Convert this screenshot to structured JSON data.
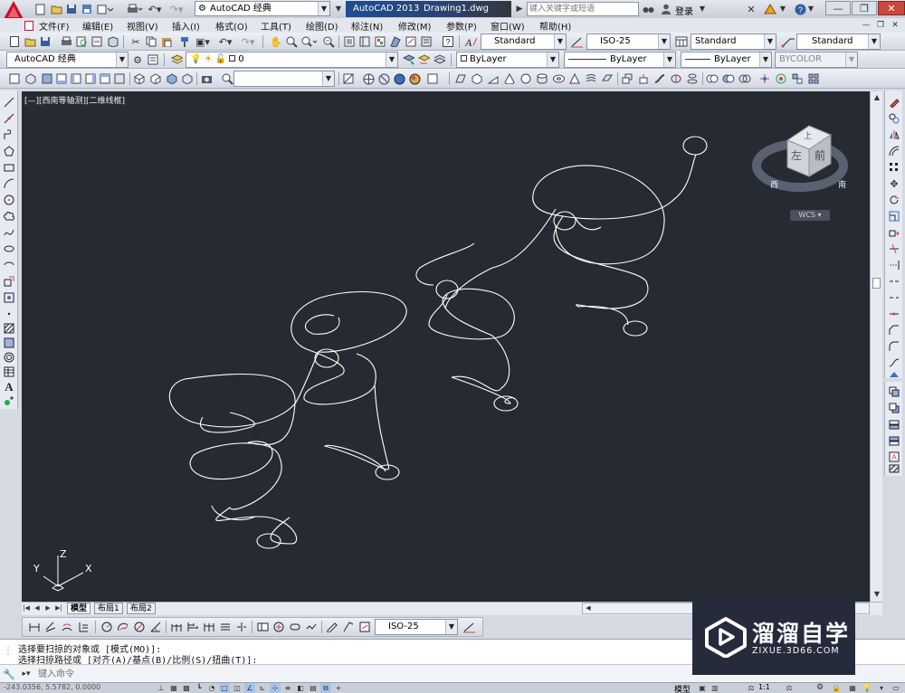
{
  "title_bar": {
    "workspace": "AutoCAD 经典",
    "app_name": "AutoCAD 2013",
    "document": "Drawing1.dwg",
    "search_placeholder": "键入关键字或短语",
    "login_label": "登录"
  },
  "menu": [
    "文件(F)",
    "编辑(E)",
    "视图(V)",
    "插入(I)",
    "格式(O)",
    "工具(T)",
    "绘图(D)",
    "标注(N)",
    "修改(M)",
    "参数(P)",
    "窗口(W)",
    "帮助(H)"
  ],
  "styles_toolbar": {
    "text_style": "Standard",
    "dim_style": "ISO-25",
    "table_style": "Standard",
    "multileader_style": "Standard"
  },
  "layers_toolbar": {
    "workspace": "AutoCAD 经典",
    "current_layer": "0",
    "color": "ByLayer",
    "linetype": "ByLayer",
    "lineweight": "ByLayer",
    "plot_style": "BYCOLOR"
  },
  "viewport": {
    "label": "[—][西南等轴测][二维线框]",
    "viewcube_top": "上",
    "viewcube_left": "左",
    "viewcube_front": "前",
    "compass_west": "西",
    "compass_south": "南",
    "wcs_label": "WCS",
    "ucs_x": "X",
    "ucs_y": "Y",
    "ucs_z": "Z"
  },
  "layout_tabs": [
    "模型",
    "布局1",
    "布局2"
  ],
  "dim_toolbar": {
    "dim_style": "ISO-25"
  },
  "command_line": {
    "history": [
      "选择要扫掠的对象或 [模式(MO)]:",
      "选择扫掠路径或 [对齐(A)/基点(B)/比例(S)/扭曲(T)]:"
    ],
    "prompt_placeholder": "键入命令"
  },
  "status_bar": {
    "coordinates": "-243.0356, 5.5782, 0.0000",
    "model_label": "模型",
    "scale_label": "1:1"
  },
  "watermark": {
    "brand": "溜溜自学",
    "url": "ZIXUE.3D66.COM"
  },
  "colors": {
    "canvas": "#252a33",
    "curves": "#ffffff",
    "logo_bg": "#262b3c"
  }
}
